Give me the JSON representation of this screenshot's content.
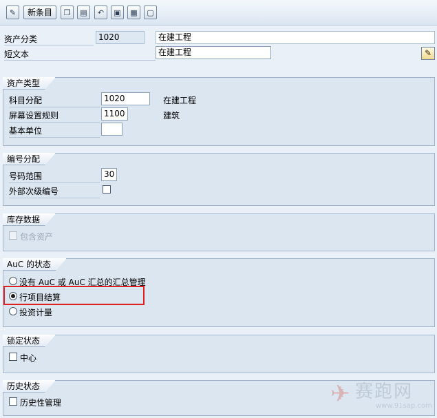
{
  "toolbar": {
    "new_entry_label": "新条目",
    "icons": [
      "edit-pen-icon",
      "copy-icon",
      "delete-icon",
      "undo-icon",
      "select-all-icon",
      "select-block-icon",
      "deselect-icon"
    ]
  },
  "header": {
    "asset_class_label": "资产分类",
    "asset_class_value": "1020",
    "asset_class_desc": "在建工程",
    "short_text_label": "短文本",
    "short_text_value": "在建工程"
  },
  "asset_type": {
    "title": "资产类型",
    "account_determination_label": "科目分配",
    "account_determination_value": "1020",
    "account_determination_desc": "在建工程",
    "screen_layout_label": "屏幕设置规则",
    "screen_layout_value": "1100",
    "screen_layout_desc": "建筑",
    "base_unit_label": "基本单位",
    "base_unit_value": ""
  },
  "number_assignment": {
    "title": "编号分配",
    "number_range_label": "号码范围",
    "number_range_value": "30",
    "external_subnumber_label": "外部次级编号"
  },
  "inventory": {
    "title": "库存数据",
    "include_asset_label": "包含资产"
  },
  "auc_status": {
    "title": "AuC 的状态",
    "options": [
      "没有 AuC 或 AuC 汇总的汇总管理",
      "行项目结算",
      "投资计量"
    ],
    "selected_index": 1
  },
  "lock_status": {
    "title": "锁定状态",
    "center_label": "中心"
  },
  "history_status": {
    "title": "历史状态",
    "history_mgmt_label": "历史性管理"
  },
  "watermark": {
    "site_name": "赛跑网",
    "site_url": "www.91sap.com"
  }
}
